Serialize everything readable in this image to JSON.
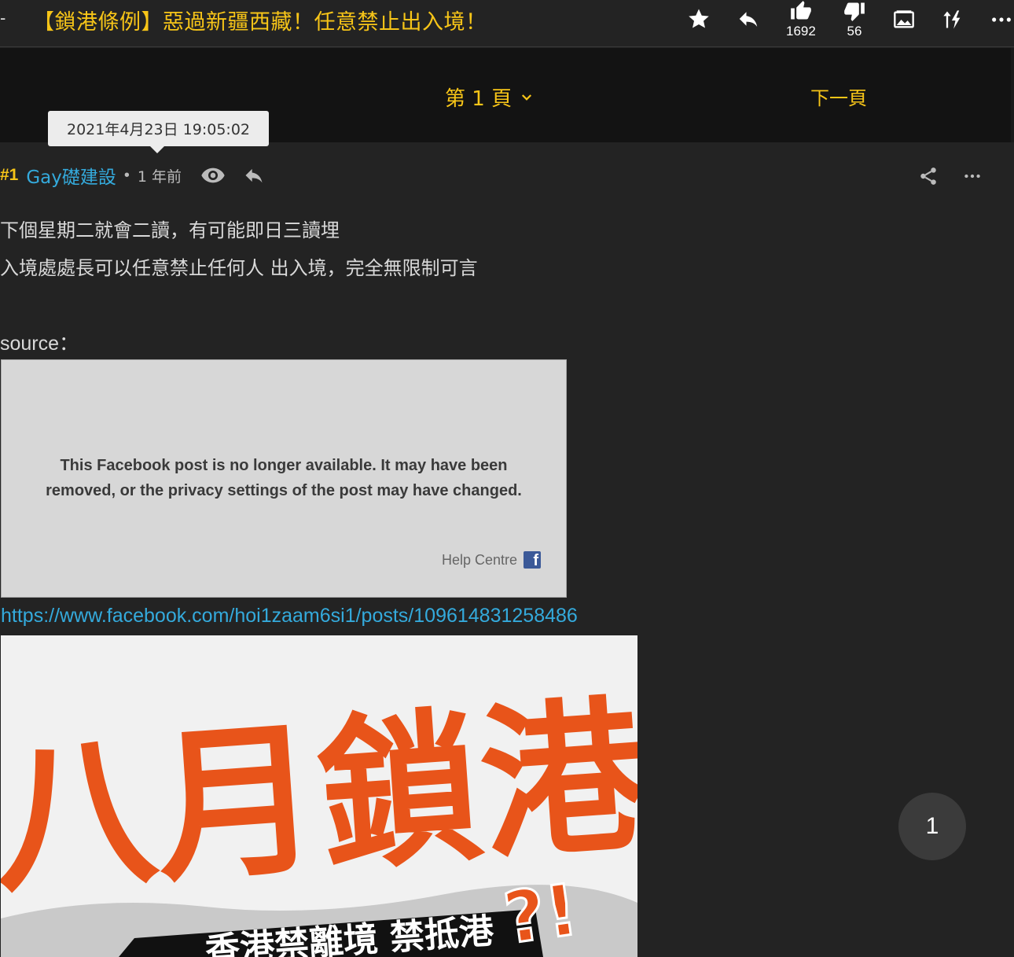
{
  "topbar": {
    "back_dash": "-",
    "title": "【鎖港條例】惡過新疆西藏！任意禁止出入境！",
    "like_count": "1692",
    "dislike_count": "56"
  },
  "pagebar": {
    "page_label": "第 1 頁",
    "next_label": "下一頁"
  },
  "tooltip": {
    "datetime": "2021年4月23日 19:05:02"
  },
  "post": {
    "floor": "#1",
    "author": "Gay礎建設",
    "separator": "•",
    "time_ago": "1 年前",
    "lines": [
      "下個星期二就會二讀，有可能即日三讀埋",
      "入境處處長可以任意禁止任何人 出入境，完全無限制可言"
    ],
    "source_label": "source：",
    "fb_embed": {
      "message_line1": "This Facebook post is no longer available. It may have been",
      "message_line2": "removed, or the privacy settings of the post may have changed.",
      "help_label": "Help Centre",
      "fb_logo": "f"
    },
    "link": "https://www.facebook.com/hoi1zaam6si1/posts/109614831258486",
    "poster": {
      "headline": "八月鎖港",
      "punct": "?!",
      "banner": "香港禁離境 禁抵港"
    }
  },
  "scroll_button": {
    "label": "1"
  },
  "colors": {
    "accent": "#f7c518",
    "link": "#34aadc",
    "poster_orange": "#e8541a"
  }
}
